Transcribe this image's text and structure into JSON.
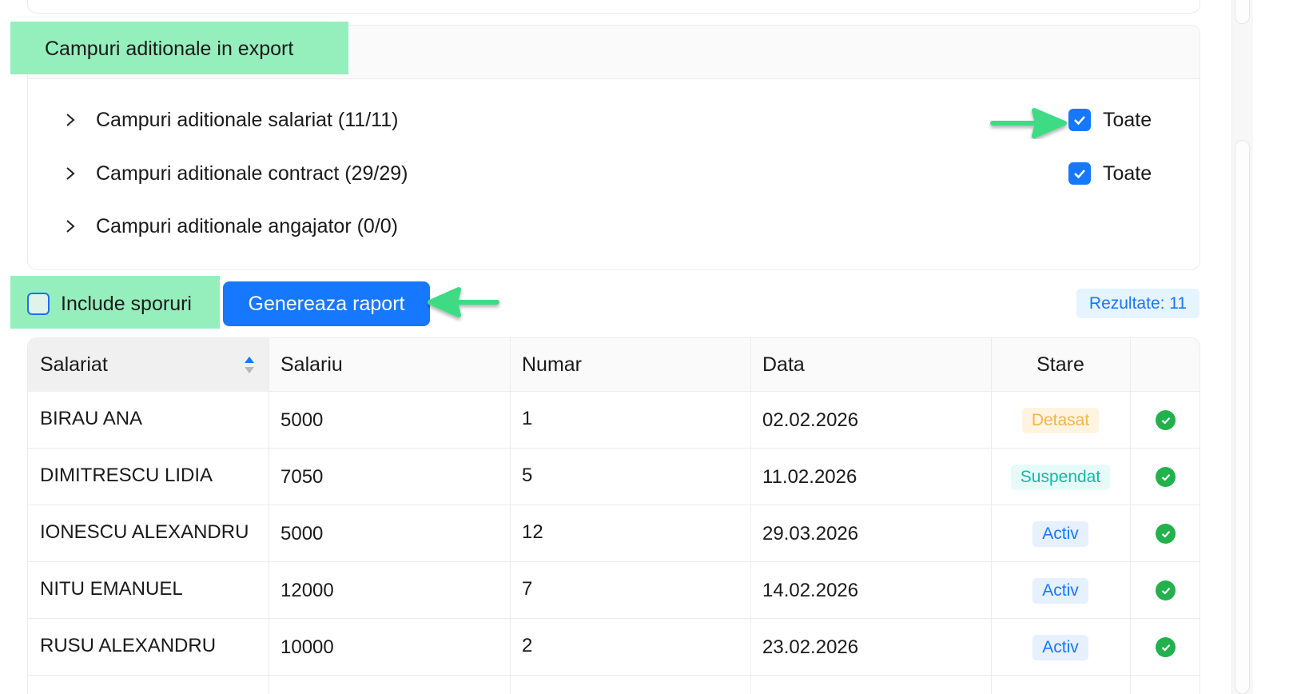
{
  "additional_fields": {
    "title": "Campuri aditionale in export",
    "rows": [
      {
        "label": "Campuri aditionale salariat (11/11)",
        "toate": "Toate",
        "checked": true
      },
      {
        "label": "Campuri aditionale contract (29/29)",
        "toate": "Toate",
        "checked": true
      },
      {
        "label": "Campuri aditionale angajator (0/0)"
      }
    ]
  },
  "actions": {
    "include_label": "Include sporuri",
    "include_checked": false,
    "generate_label": "Genereaza raport",
    "results_label": "Rezultate: 11"
  },
  "table": {
    "headers": [
      "Salariat",
      "Salariu",
      "Numar",
      "Data",
      "Stare",
      ""
    ],
    "sorted_column": "Salariat",
    "rows": [
      {
        "salariat": "BIRAU ANA",
        "salariu": "5000",
        "numar": "1",
        "data": "02.02.2026",
        "stare": "Detasat"
      },
      {
        "salariat": "DIMITRESCU LIDIA",
        "salariu": "7050",
        "numar": "5",
        "data": "11.02.2026",
        "stare": "Suspendat"
      },
      {
        "salariat": "IONESCU ALEXANDRU",
        "salariu": "5000",
        "numar": "12",
        "data": "29.03.2026",
        "stare": "Activ"
      },
      {
        "salariat": "NITU EMANUEL",
        "salariu": "12000",
        "numar": "7",
        "data": "14.02.2026",
        "stare": "Activ"
      },
      {
        "salariat": "RUSU ALEXANDRU",
        "salariu": "10000",
        "numar": "2",
        "data": "23.02.2026",
        "stare": "Activ"
      }
    ]
  },
  "colors": {
    "primary": "#1677ff",
    "highlight": "#95efbd",
    "arrow": "#3ddc84",
    "detasat_bg": "#fff4e0",
    "detasat_fg": "#f5b547",
    "suspendat_bg": "#e6fbf8",
    "suspendat_fg": "#13b8a6",
    "activ_bg": "#e6f0ff",
    "activ_fg": "#1677ff",
    "status_ok": "#22b14c"
  },
  "icons": [
    "chevron-right-icon",
    "checkbox-checked-icon",
    "checkbox-empty-icon",
    "sort-icon",
    "check-circle-icon",
    "arrow-icon"
  ]
}
